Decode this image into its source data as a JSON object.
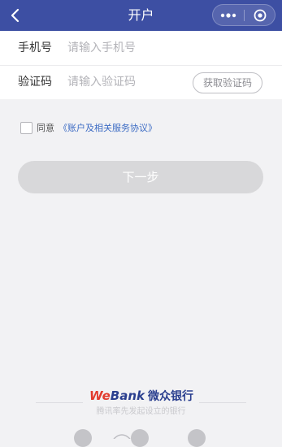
{
  "navbar": {
    "title": "开户",
    "back_icon": "chevron-left-icon",
    "more_icon": "more-dots-icon",
    "close_icon": "record-circle-icon",
    "background": "#3d4fa3"
  },
  "form": {
    "phone": {
      "label": "手机号",
      "placeholder": "请输入手机号",
      "value": ""
    },
    "code": {
      "label": "验证码",
      "placeholder": "请输入验证码",
      "value": "",
      "button_label": "获取验证码"
    }
  },
  "agreement": {
    "checked": false,
    "prefix": "同意",
    "link_text": "《账户及相关服务协议》"
  },
  "next_button": {
    "label": "下一步",
    "enabled": false
  },
  "footer": {
    "brand_we": "We",
    "brand_bank": "Bank",
    "brand_cn": "微众银行",
    "tagline": "腾讯率先发起设立的银行",
    "brand_red": "#e23b2e",
    "brand_blue": "#2a3f8f"
  },
  "bottom_icons": [
    "tab-icon",
    "tab-icon",
    "tab-icon",
    "tab-icon"
  ]
}
